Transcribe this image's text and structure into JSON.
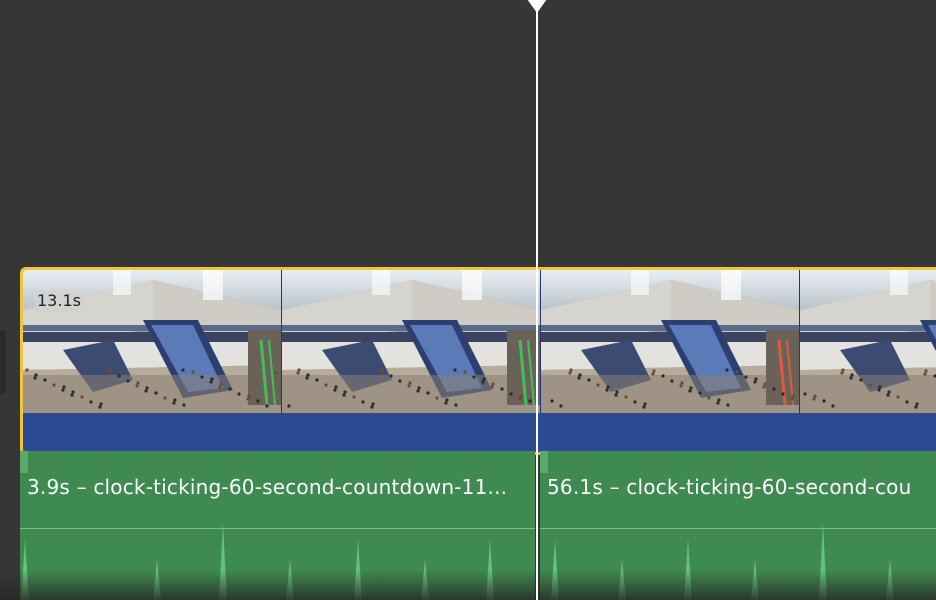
{
  "timeline": {
    "video_clip": {
      "duration_label": "13.1s",
      "border_color": "#f1c53a",
      "audio_band_color": "#2b4a94",
      "thumbnail_count": 4
    },
    "audio_clips": [
      {
        "label": "3.9s – clock-ticking-60-second-countdown-11...",
        "color": "#3f8a50"
      },
      {
        "label": "56.1s – clock-ticking-60-second-cou",
        "color": "#3f8a50"
      }
    ],
    "playhead_color": "#ffffff",
    "background_color": "#363636"
  }
}
